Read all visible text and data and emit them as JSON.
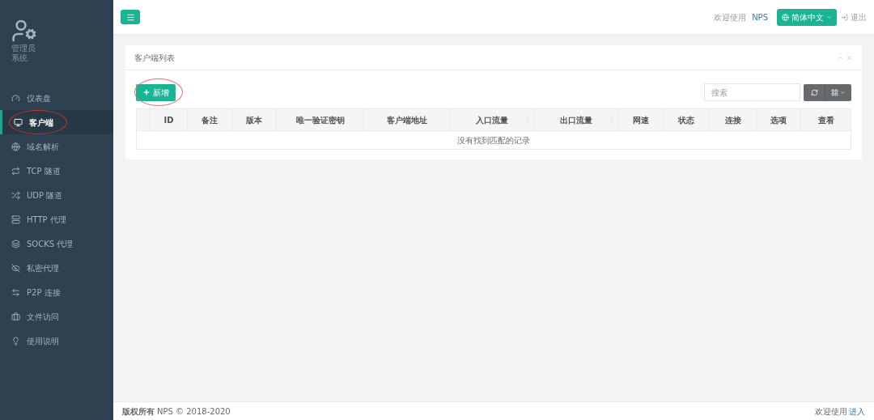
{
  "sidebar": {
    "user": {
      "name": "管理员",
      "role": "系统"
    },
    "items": [
      {
        "label": "仪表盘",
        "selected": false,
        "circled": false
      },
      {
        "label": "客户端",
        "selected": true,
        "circled": true
      },
      {
        "label": "域名解析",
        "selected": false,
        "circled": false
      },
      {
        "label": "TCP 隧道",
        "selected": false,
        "circled": false
      },
      {
        "label": "UDP 隧道",
        "selected": false,
        "circled": false
      },
      {
        "label": "HTTP 代理",
        "selected": false,
        "circled": false
      },
      {
        "label": "SOCKS 代理",
        "selected": false,
        "circled": false
      },
      {
        "label": "私密代理",
        "selected": false,
        "circled": false
      },
      {
        "label": "P2P 连接",
        "selected": false,
        "circled": false
      },
      {
        "label": "文件访问",
        "selected": false,
        "circled": false
      },
      {
        "label": "使用说明",
        "selected": false,
        "circled": false
      }
    ]
  },
  "topbar": {
    "welcome": "欢迎使用",
    "brand": "NPS",
    "language": "简体中文",
    "logout": "退出"
  },
  "panel": {
    "title": "客户端列表",
    "add_button": {
      "label": "新增",
      "circled": true
    },
    "search": {
      "placeholder": "搜索"
    },
    "table": {
      "columns": [
        {
          "label": "ID",
          "sortable": false
        },
        {
          "label": "备注",
          "sortable": false
        },
        {
          "label": "版本",
          "sortable": false
        },
        {
          "label": "唯一验证密钥",
          "sortable": false
        },
        {
          "label": "客户端地址",
          "sortable": false
        },
        {
          "label": "入口流量",
          "sortable": true
        },
        {
          "label": "出口流量",
          "sortable": true
        },
        {
          "label": "网速",
          "sortable": false
        },
        {
          "label": "状态",
          "sortable": false
        },
        {
          "label": "连接",
          "sortable": false
        },
        {
          "label": "选项",
          "sortable": false
        },
        {
          "label": "查看",
          "sortable": false
        }
      ],
      "empty_message": "没有找到匹配的记录"
    }
  },
  "footer": {
    "copyright_label": "版权所有",
    "copyright": "NPS © 2018-2020",
    "right_text": "欢迎使用",
    "right_link": "进入"
  }
}
